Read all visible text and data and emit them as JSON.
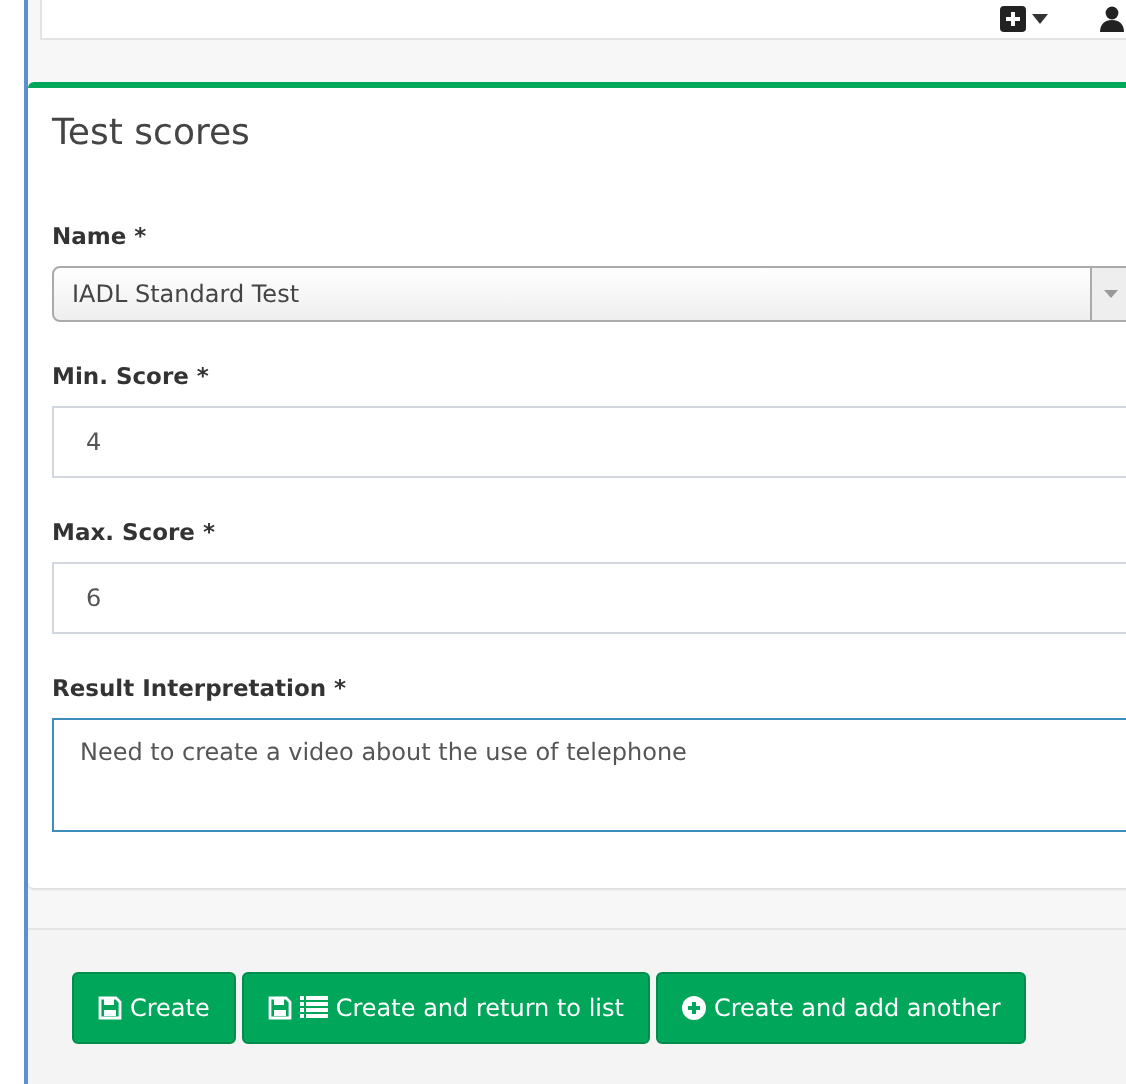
{
  "toolbar": {
    "items": [
      {
        "kind": "plus"
      },
      {
        "kind": "user"
      }
    ]
  },
  "form": {
    "title": "Test scores",
    "fields": [
      {
        "kind": "select",
        "label": "Name *",
        "value": "IADL Standard Test"
      },
      {
        "kind": "input",
        "label": "Min. Score *",
        "value": "4"
      },
      {
        "kind": "input",
        "label": "Max. Score *",
        "value": "6"
      },
      {
        "kind": "textarea",
        "label": "Result Interpretation *",
        "value": "Need to create a video about the use of telephone",
        "focused": true
      }
    ]
  },
  "buttons": [
    {
      "kind": "save",
      "label": "Create"
    },
    {
      "kind": "save-list",
      "label": "Create and return to list"
    },
    {
      "kind": "add",
      "label": "Create and add another"
    }
  ]
}
